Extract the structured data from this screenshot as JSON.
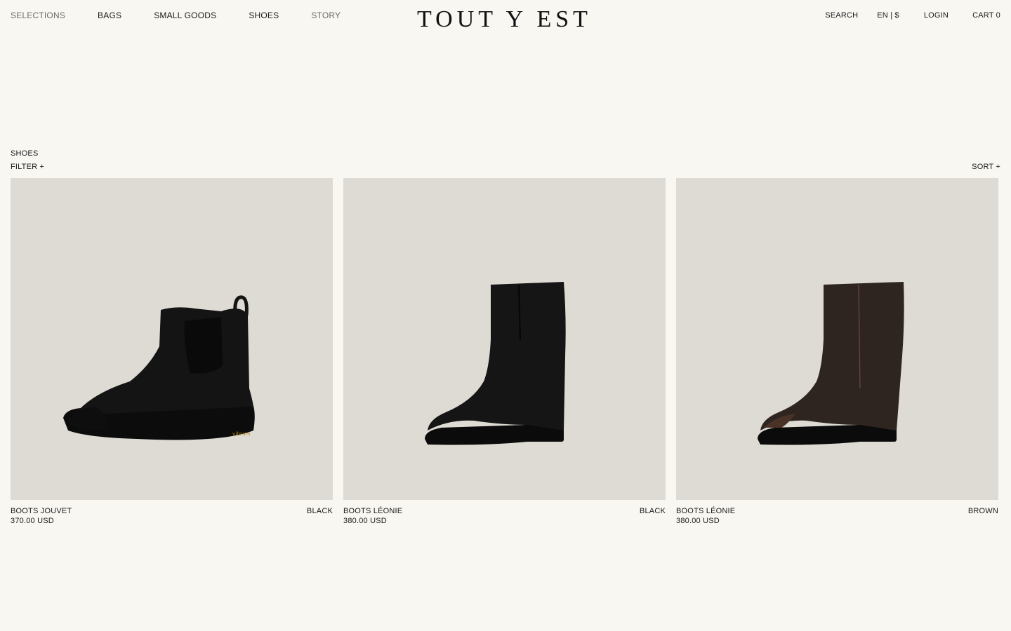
{
  "nav": {
    "items": [
      {
        "label": "SELECTIONS",
        "dim": true
      },
      {
        "label": "BAGS",
        "dim": false
      },
      {
        "label": "SMALL GOODS",
        "dim": false
      },
      {
        "label": "SHOES",
        "dim": false
      },
      {
        "label": "STORY",
        "dim": true
      }
    ]
  },
  "logo": "TOUT Y EST",
  "utility": {
    "search": "SEARCH",
    "locale": "EN | $",
    "login": "LOGIN",
    "cart": "CART 0"
  },
  "listing": {
    "title": "SHOES",
    "filter": "FILTER +",
    "sort": "SORT  +"
  },
  "products": [
    {
      "name": "BOOTS JOUVET",
      "price": "370.00 USD",
      "color": "BLACK",
      "icon": "chelsea-boot-black",
      "shade": "#141414"
    },
    {
      "name": "BOOTS LÉONIE",
      "price": "380.00 USD",
      "color": "BLACK",
      "icon": "pull-on-boot-black",
      "shade": "#151515"
    },
    {
      "name": "BOOTS LÉONIE",
      "price": "380.00 USD",
      "color": "BROWN",
      "icon": "pull-on-boot-brown",
      "shade": "#2e2520"
    }
  ],
  "colors": {
    "background": "#f8f7f2",
    "photo_bg": "#dedbd4",
    "text": "#1a1a1a"
  }
}
